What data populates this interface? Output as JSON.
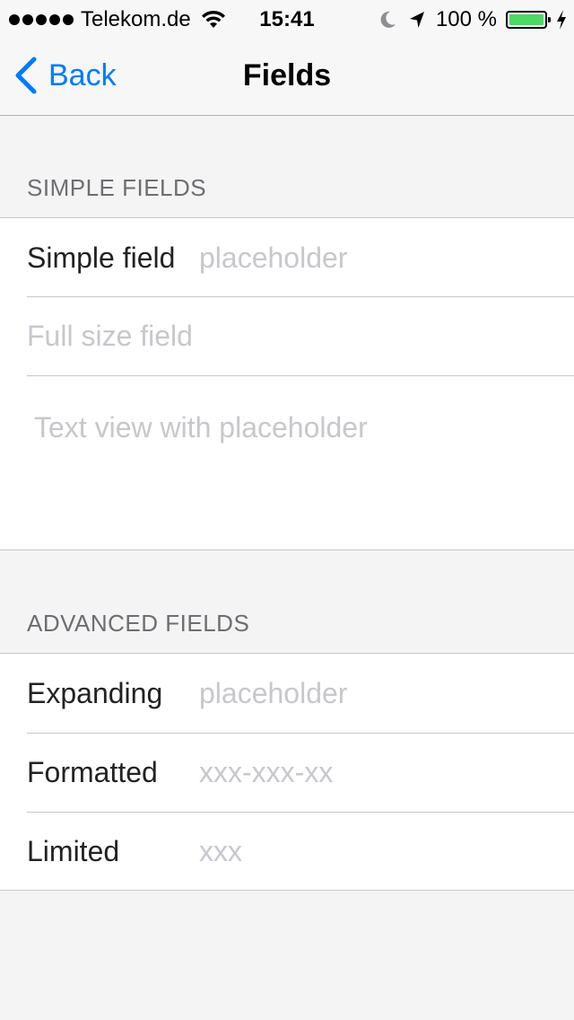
{
  "status_bar": {
    "carrier": "Telekom.de",
    "time": "15:41",
    "battery": "100 %",
    "battery_level": 1.0,
    "signal_dots": 5
  },
  "nav": {
    "back_label": "Back",
    "title": "Fields"
  },
  "simple_section": {
    "header": "SIMPLE FIELDS",
    "simple_field_label": "Simple field",
    "simple_field_placeholder": "placeholder",
    "full_size_placeholder": "Full size field",
    "text_view_placeholder": "Text view with placeholder"
  },
  "advanced_section": {
    "header": "ADVANCED FIELDS",
    "rows": [
      {
        "label": "Expanding",
        "placeholder": "placeholder"
      },
      {
        "label": "Formatted",
        "placeholder": "xxx-xxx-xx"
      },
      {
        "label": "Limited",
        "placeholder": "xxx"
      }
    ]
  },
  "colors": {
    "accent": "#007aff",
    "battery_fill": "#4cd964",
    "placeholder": "#c7c7cd",
    "section_header": "#6d6d72"
  }
}
